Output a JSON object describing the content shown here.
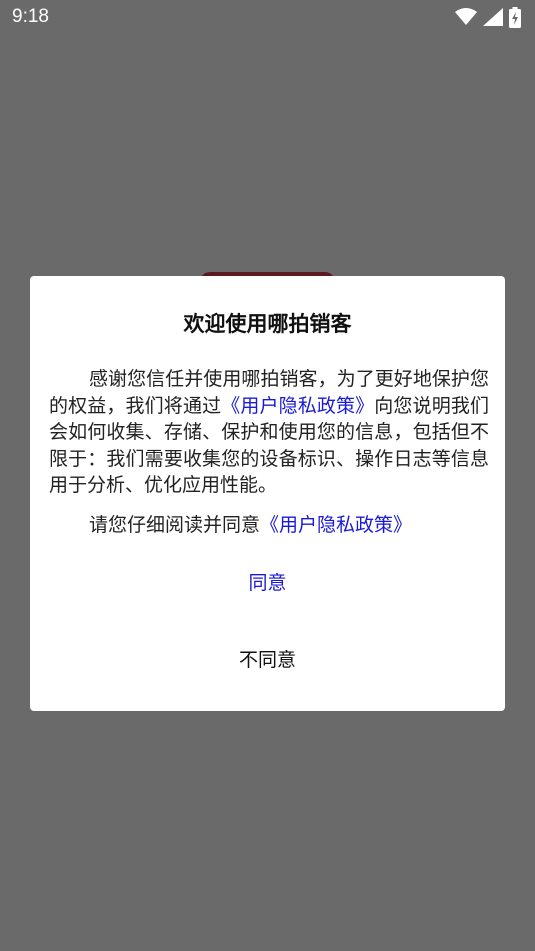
{
  "status_bar": {
    "time": "9:18"
  },
  "dialog": {
    "title": "欢迎使用哪拍销客",
    "body_part1": "感谢您信任并使用哪拍销客，为了更好地保护您的权益，我们将通过",
    "body_link": "《用户隐私政策》",
    "body_part2": "向您说明我们会如何收集、存储、保护和使用您的信息，包括但不限于：我们需要收集您的设备标识、操作日志等信息用于分析、优化应用性能。",
    "prompt_text": "请您仔细阅读并同意",
    "prompt_link": "《用户隐私政策》",
    "agree_label": "同意",
    "disagree_label": "不同意"
  },
  "colors": {
    "overlay": "#6a6a6a",
    "link": "#1a1ad6",
    "dialog_bg": "#ffffff"
  },
  "icons": [
    "wifi-icon",
    "cell-signal-icon",
    "battery-charging-icon"
  ]
}
